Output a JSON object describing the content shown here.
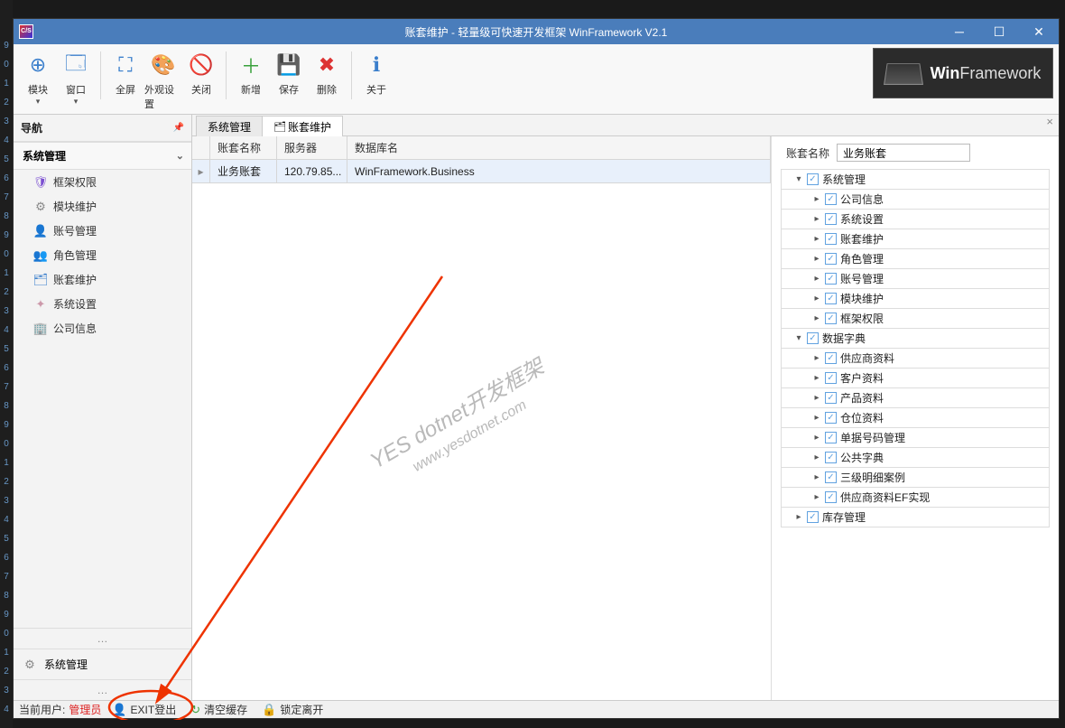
{
  "gutterStart": 9,
  "titleBar": {
    "icon": "C/S",
    "title": "账套维护 - 轻量级可快速开发框架 WinFramework V2.1"
  },
  "toolbar": {
    "items": [
      {
        "label": "模块",
        "dropdown": true,
        "group": 1,
        "iconColor": "#3b7fcc",
        "glyph": "⊕"
      },
      {
        "label": "窗口",
        "dropdown": true,
        "group": 1,
        "iconColor": "#3b7fcc",
        "glyph": "🗔"
      },
      {
        "label": "全屏",
        "group": 2,
        "iconColor": "#3b7fcc",
        "glyph": "⛶"
      },
      {
        "label": "外观设置",
        "group": 2,
        "iconColor": "#3b7fcc",
        "glyph": "🎨"
      },
      {
        "label": "关闭",
        "group": 2,
        "iconColor": "#c54",
        "glyph": "🚫"
      },
      {
        "label": "新增",
        "group": 3,
        "iconColor": "#39a13c",
        "glyph": "＋"
      },
      {
        "label": "保存",
        "group": 3,
        "iconColor": "#3b7fcc",
        "glyph": "💾"
      },
      {
        "label": "删除",
        "group": 3,
        "iconColor": "#d33",
        "glyph": "✖"
      },
      {
        "label": "关于",
        "group": 4,
        "iconColor": "#3b7fcc",
        "glyph": "ℹ"
      }
    ],
    "logo": {
      "brand": "Win",
      "rest": "Framework"
    }
  },
  "nav": {
    "header": "导航",
    "section": "系统管理",
    "items": [
      {
        "label": "框架权限",
        "icon": "🛡",
        "color": "#7b4fd1"
      },
      {
        "label": "模块维护",
        "icon": "⚙",
        "color": "#888"
      },
      {
        "label": "账号管理",
        "icon": "👤",
        "color": "#3b7fcc"
      },
      {
        "label": "角色管理",
        "icon": "👥",
        "color": "#3b7fcc"
      },
      {
        "label": "账套维护",
        "icon": "🗂",
        "color": "#3b7fcc"
      },
      {
        "label": "系统设置",
        "icon": "✦",
        "color": "#c9a"
      },
      {
        "label": "公司信息",
        "icon": "🏢",
        "color": "#3b7fcc"
      }
    ],
    "footer": {
      "label": "系统管理",
      "icon": "⚙"
    }
  },
  "tabs": [
    {
      "label": "系统管理",
      "active": false
    },
    {
      "label": "账套维护",
      "active": true,
      "icon": "🗂"
    }
  ],
  "grid": {
    "headers": {
      "name": "账套名称",
      "server": "服务器",
      "db": "数据库名"
    },
    "rows": [
      {
        "name": "业务账套",
        "server": "120.79.85...",
        "db": "WinFramework.Business"
      }
    ]
  },
  "watermark": {
    "line1": "YES dotnet开发框架",
    "line2": "www.yesdotnet.com"
  },
  "rightPane": {
    "fieldLabel": "账套名称",
    "fieldValue": "业务账套",
    "tree": [
      {
        "label": "系统管理",
        "level": 1,
        "exp": "▾",
        "checked": true,
        "children": [
          {
            "label": "公司信息",
            "level": 2,
            "exp": "▸",
            "checked": true
          },
          {
            "label": "系统设置",
            "level": 2,
            "exp": "▸",
            "checked": true
          },
          {
            "label": "账套维护",
            "level": 2,
            "exp": "▸",
            "checked": true
          },
          {
            "label": "角色管理",
            "level": 2,
            "exp": "▸",
            "checked": true
          },
          {
            "label": "账号管理",
            "level": 2,
            "exp": "▸",
            "checked": true
          },
          {
            "label": "模块维护",
            "level": 2,
            "exp": "▸",
            "checked": true
          },
          {
            "label": "框架权限",
            "level": 2,
            "exp": "▸",
            "checked": true
          }
        ]
      },
      {
        "label": "数据字典",
        "level": 1,
        "exp": "▾",
        "checked": true,
        "children": [
          {
            "label": "供应商资料",
            "level": 2,
            "exp": "▸",
            "checked": true
          },
          {
            "label": "客户资料",
            "level": 2,
            "exp": "▸",
            "checked": true
          },
          {
            "label": "产品资料",
            "level": 2,
            "exp": "▸",
            "checked": true
          },
          {
            "label": "仓位资料",
            "level": 2,
            "exp": "▸",
            "checked": true
          },
          {
            "label": "单据号码管理",
            "level": 2,
            "exp": "▸",
            "checked": true
          },
          {
            "label": "公共字典",
            "level": 2,
            "exp": "▸",
            "checked": true
          },
          {
            "label": "三级明细案例",
            "level": 2,
            "exp": "▸",
            "checked": true
          },
          {
            "label": "供应商资料EF实现",
            "level": 2,
            "exp": "▸",
            "checked": true
          }
        ]
      },
      {
        "label": "库存管理",
        "level": 1,
        "exp": "▸",
        "checked": true
      }
    ]
  },
  "statusBar": {
    "currentUserLabel": "当前用户:",
    "currentUser": "管理员",
    "exit": "EXIT登出",
    "clearCache": "清空缓存",
    "lockLeave": "锁定离开"
  }
}
